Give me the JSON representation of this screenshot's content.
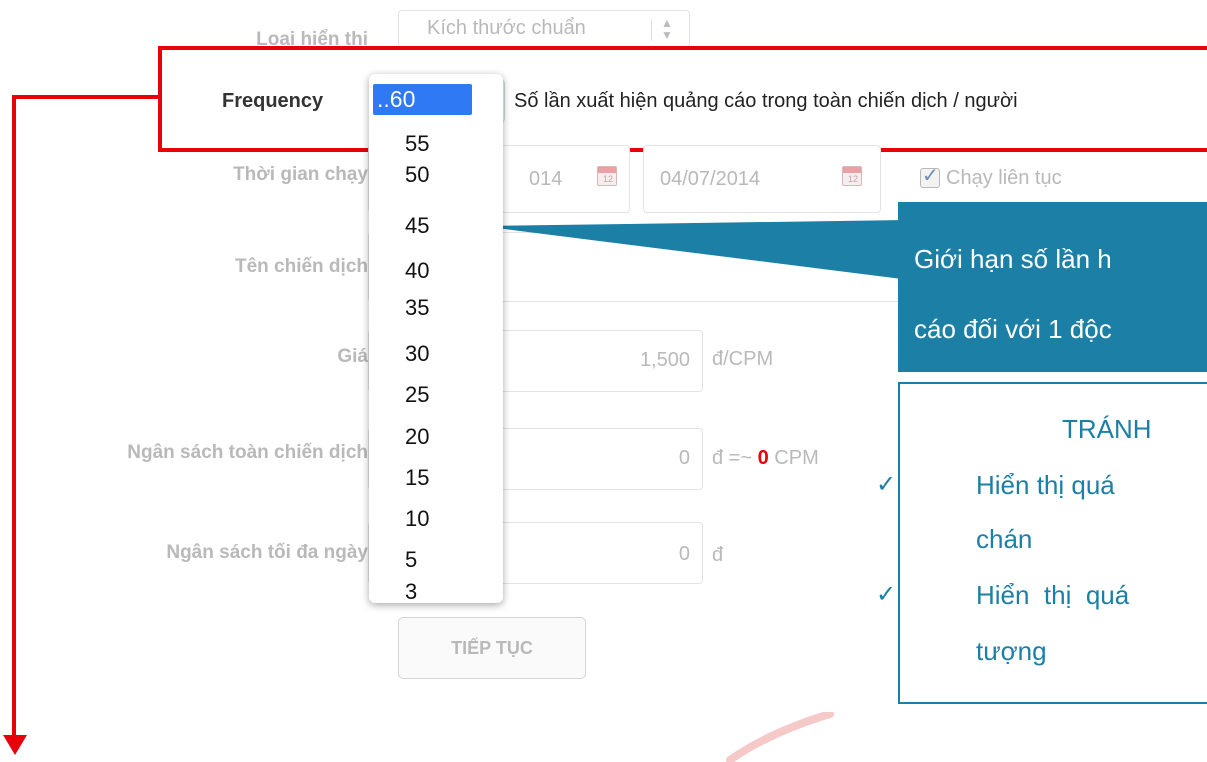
{
  "form": {
    "display_type_label": "Loại hiển thị",
    "display_type_value": "Kích thước chuẩn",
    "frequency_label": "Frequency",
    "frequency_desc": "Số lần xuất hiện quảng cáo trong toàn chiến dịch / người",
    "run_time_label": "Thời gian chạy",
    "start_date": "014",
    "end_date": "04/07/2014",
    "continuous_label": "Chạy liên tục",
    "campaign_name_label": "Tên chiến dịch",
    "price_label": "Giá",
    "price_value": "1,500",
    "price_unit": "đ/CPM",
    "total_budget_label": "Ngân sách toàn chiến dịch",
    "total_budget_value": "0",
    "total_budget_unit_pre": "đ =~",
    "total_budget_cpm": "0",
    "total_budget_unit_post": "CPM",
    "daily_budget_label": "Ngân sách tối đa ngày",
    "daily_budget_value": "0",
    "daily_budget_unit": "đ",
    "continue_button": "TIẾP TỤC",
    "calendar_day": "12"
  },
  "dropdown": {
    "selected": "..60",
    "options": [
      "55",
      "50",
      "45",
      "40",
      "35",
      "30",
      "25",
      "20",
      "15",
      "10",
      "5",
      "3"
    ]
  },
  "callout": {
    "line1": "Giới hạn số lần h",
    "line2": "cáo đối với 1 độc"
  },
  "avoid_box": {
    "title": "TRÁNH",
    "item1_line1": "Hiển thị quá",
    "item1_line2": "chán",
    "item2_line1": "Hiển  thị  quá",
    "item2_line2": "tượng",
    "check_glyph": "✓"
  },
  "colors": {
    "highlight_red": "#e8000b",
    "callout_blue": "#1b7fa6",
    "select_blue": "#2f79f4",
    "zero_red": "#e8000b"
  }
}
